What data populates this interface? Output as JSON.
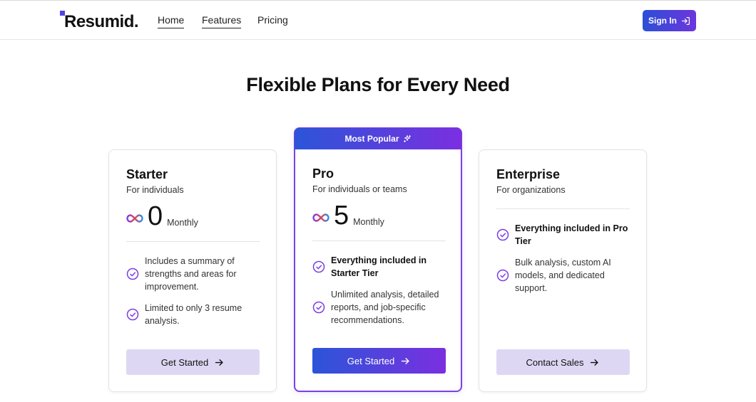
{
  "brand": {
    "name": "Resumid.",
    "accent": "#4f46e5"
  },
  "nav": {
    "links": [
      {
        "label": "Home"
      },
      {
        "label": "Features"
      },
      {
        "label": "Pricing"
      }
    ],
    "signin_label": "Sign In"
  },
  "page": {
    "title": "Flexible Plans for Every Need"
  },
  "plans": [
    {
      "name": "Starter",
      "subtitle": "For individuals",
      "price": "0",
      "period": "Monthly",
      "features": [
        "Includes a summary of strengths and areas for improvement.",
        "Limited to only 3 resume analysis."
      ],
      "button_label": "Get Started"
    },
    {
      "badge": "Most Popular",
      "name": "Pro",
      "subtitle": "For individuals or teams",
      "price": "5",
      "period": "Monthly",
      "features": [
        "Everything included in Starter Tier",
        "Unlimited analysis, detailed reports, and job-specific recommendations."
      ],
      "button_label": "Get Started"
    },
    {
      "name": "Enterprise",
      "subtitle": "For organizations",
      "features": [
        "Everything included in Pro Tier",
        "Bulk analysis, custom AI models, and dedicated support."
      ],
      "button_label": "Contact Sales"
    }
  ],
  "colors": {
    "gradient_start": "#2b55d8",
    "gradient_end": "#7b2fe0",
    "button_light": "#ded7f4",
    "check_purple": "#7b3fe4"
  },
  "icons": {
    "signin": "sign-in-icon",
    "sparkle": "sparkle-icon",
    "infinity": "infinity-icon",
    "check": "check-circle-icon",
    "arrow": "arrow-right-icon"
  }
}
